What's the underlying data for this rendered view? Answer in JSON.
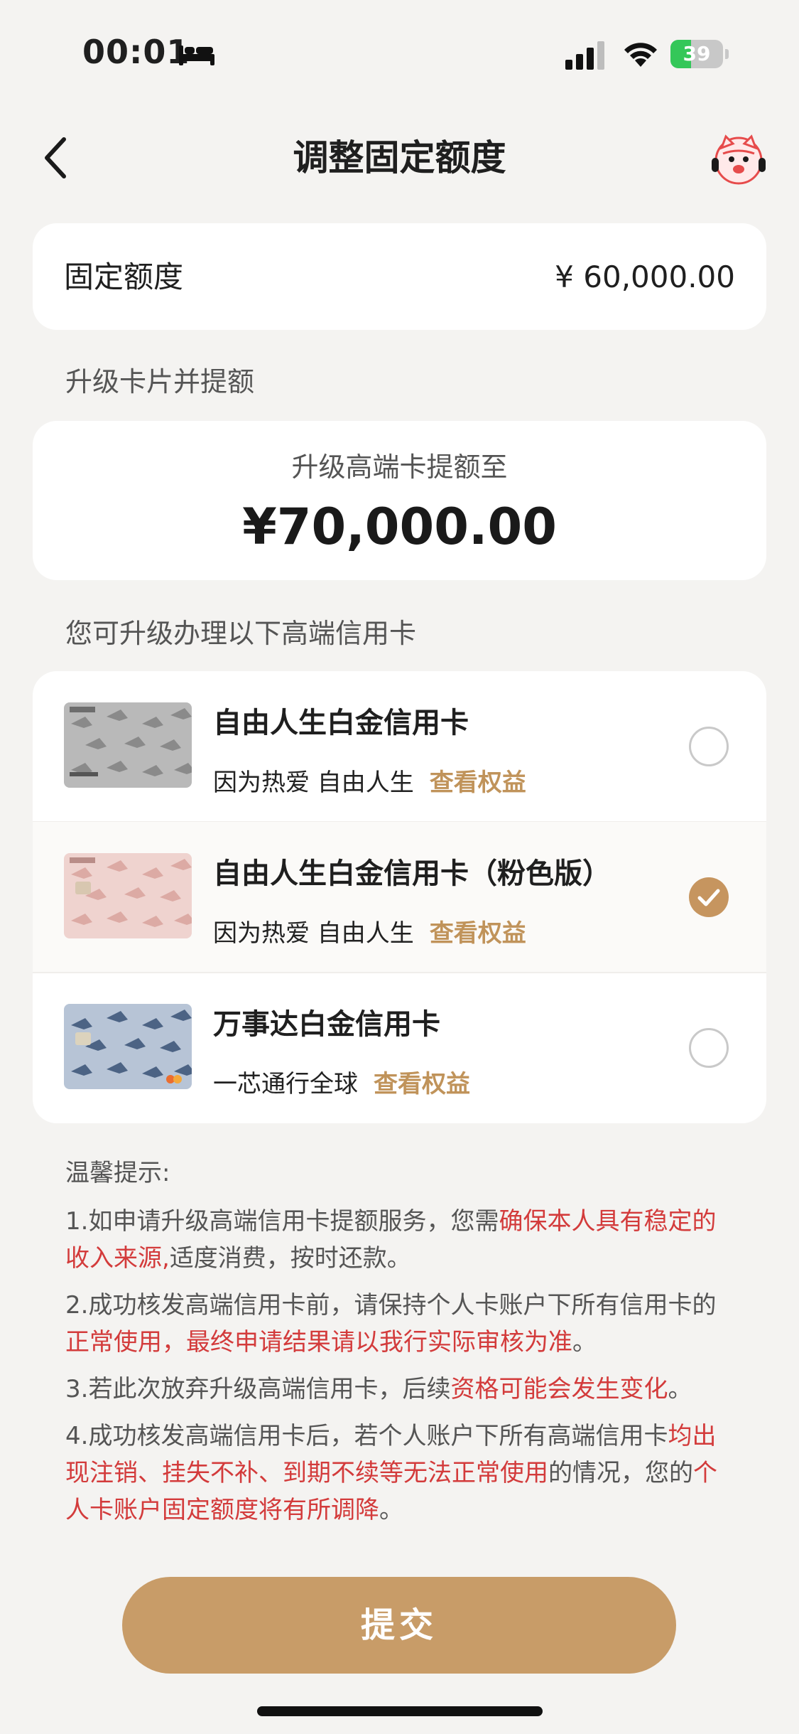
{
  "status_bar": {
    "time": "00:01",
    "battery": "39",
    "battery_level": 0.39,
    "icons": [
      "bed-icon",
      "signal-icon",
      "wifi-icon",
      "battery-icon"
    ]
  },
  "nav": {
    "title": "调整固定额度",
    "back_icon": "chevron-left-icon",
    "service_icon": "customer-service-avatar-icon"
  },
  "fixed_limit": {
    "label": "固定额度",
    "value": "¥ 60,000.00"
  },
  "upgrade": {
    "section_label": "升级卡片并提额",
    "subtitle": "升级高端卡提额至",
    "amount": "¥70,000.00"
  },
  "cards": {
    "section_label": "您可升级办理以下高端信用卡",
    "link_label": "查看权益",
    "items": [
      {
        "name": "自由人生白金信用卡",
        "slogan": "因为热爱 自由人生",
        "selected": false
      },
      {
        "name": "自由人生白金信用卡（粉色版）",
        "slogan": "因为热爱 自由人生",
        "selected": true
      },
      {
        "name": "万事达白金信用卡",
        "slogan": "一芯通行全球",
        "selected": false
      }
    ]
  },
  "tips": {
    "title": "温馨提示:",
    "t1a": "1.如申请升级高端信用卡提额服务，您需",
    "t1b": "确保本人具有稳定的收入来源,",
    "t1c": "适度消费，按时还款。",
    "t2a": "2.成功核发高端信用卡前，请保持个人卡账户下所有信用卡的",
    "t2b": "正常使用，最终申请结果请以我行实际审核为准",
    "t2c": "。",
    "t3a": "3.若此次放弃升级高端信用卡，后续",
    "t3b": "资格可能会发生变化",
    "t3c": "。",
    "t4a": "4.成功核发高端信用卡后，若个人账户下所有高端信用卡",
    "t4b": "均出现注销、挂失不补、到期不续等无法正常使用",
    "t4c": "的情况，您的",
    "t4d": "个人卡账户固定额度将有所调降",
    "t4e": "。"
  },
  "colors": {
    "accent": "#c89c68",
    "link": "#c0935a",
    "warning": "#d33b3b",
    "background": "#f4f3f1"
  },
  "submit_label": "提交"
}
